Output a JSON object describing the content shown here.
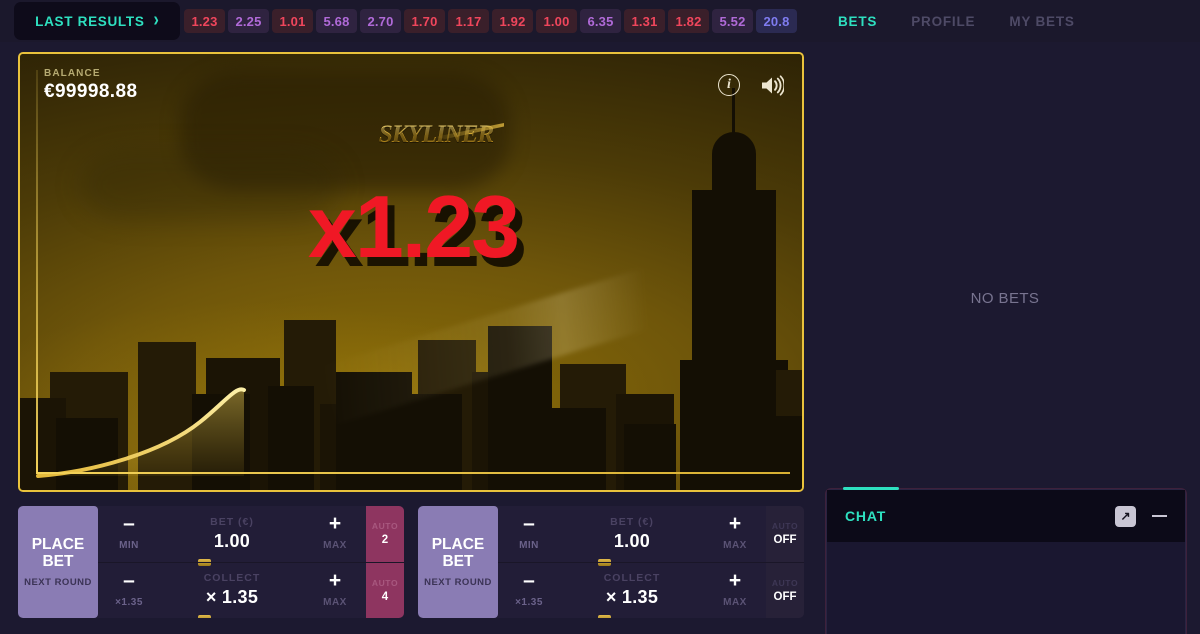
{
  "topbar": {
    "last_results_label": "LAST RESULTS",
    "chevron_icon": "chevron-right-icon",
    "results": [
      {
        "value": "1.23",
        "tone": "red"
      },
      {
        "value": "2.25",
        "tone": "pink"
      },
      {
        "value": "1.01",
        "tone": "red"
      },
      {
        "value": "5.68",
        "tone": "pink"
      },
      {
        "value": "2.70",
        "tone": "pink"
      },
      {
        "value": "1.70",
        "tone": "red"
      },
      {
        "value": "1.17",
        "tone": "red"
      },
      {
        "value": "1.92",
        "tone": "red"
      },
      {
        "value": "1.00",
        "tone": "red"
      },
      {
        "value": "6.35",
        "tone": "pink"
      },
      {
        "value": "1.31",
        "tone": "red"
      },
      {
        "value": "1.82",
        "tone": "red"
      },
      {
        "value": "5.52",
        "tone": "pink"
      },
      {
        "value": "20.8",
        "tone": "blue"
      }
    ],
    "tabs": [
      {
        "label": "BETS",
        "state": "active"
      },
      {
        "label": "PROFILE",
        "state": "idle"
      },
      {
        "label": "MY BETS",
        "state": "idle"
      }
    ]
  },
  "game": {
    "balance_label": "BALANCE",
    "balance_value": "€99998.88",
    "logo_text": "SKYLINER",
    "multiplier": "x1.23",
    "info_icon": "info-icon",
    "info_glyph": "i",
    "sound_icon": "volume-on-icon",
    "accent_gold": "#e9c23c",
    "multiplier_color": "#f01825"
  },
  "bets_panel": {
    "empty_message": "NO BETS"
  },
  "chat": {
    "title": "CHAT",
    "expand_icon": "expand-arrow-icon",
    "expand_glyph": "↗",
    "minimize_icon": "minimize-icon"
  },
  "bet_panels": [
    {
      "place_bet_label": "PLACE\nBET",
      "next_round_label": "NEXT ROUND",
      "rows": [
        {
          "minus_sign": "–",
          "minus_cap": "MIN",
          "label": "BET (€)",
          "value": "1.00",
          "plus_sign": "+",
          "plus_cap": "MAX",
          "auto_label": "AUTO",
          "auto_value": "2",
          "auto_state": "on"
        },
        {
          "minus_sign": "–",
          "minus_cap": "×1.35",
          "label": "COLLECT",
          "value": "× 1.35",
          "plus_sign": "+",
          "plus_cap": "MAX",
          "auto_label": "AUTO",
          "auto_value": "4",
          "auto_state": "on"
        }
      ]
    },
    {
      "place_bet_label": "PLACE\nBET",
      "next_round_label": "NEXT ROUND",
      "rows": [
        {
          "minus_sign": "–",
          "minus_cap": "MIN",
          "label": "BET (€)",
          "value": "1.00",
          "plus_sign": "+",
          "plus_cap": "MAX",
          "auto_label": "AUTO",
          "auto_value": "OFF",
          "auto_state": "off"
        },
        {
          "minus_sign": "–",
          "minus_cap": "×1.35",
          "label": "COLLECT",
          "value": "× 1.35",
          "plus_sign": "+",
          "plus_cap": "MAX",
          "auto_label": "AUTO",
          "auto_value": "OFF",
          "auto_state": "off"
        }
      ]
    }
  ]
}
